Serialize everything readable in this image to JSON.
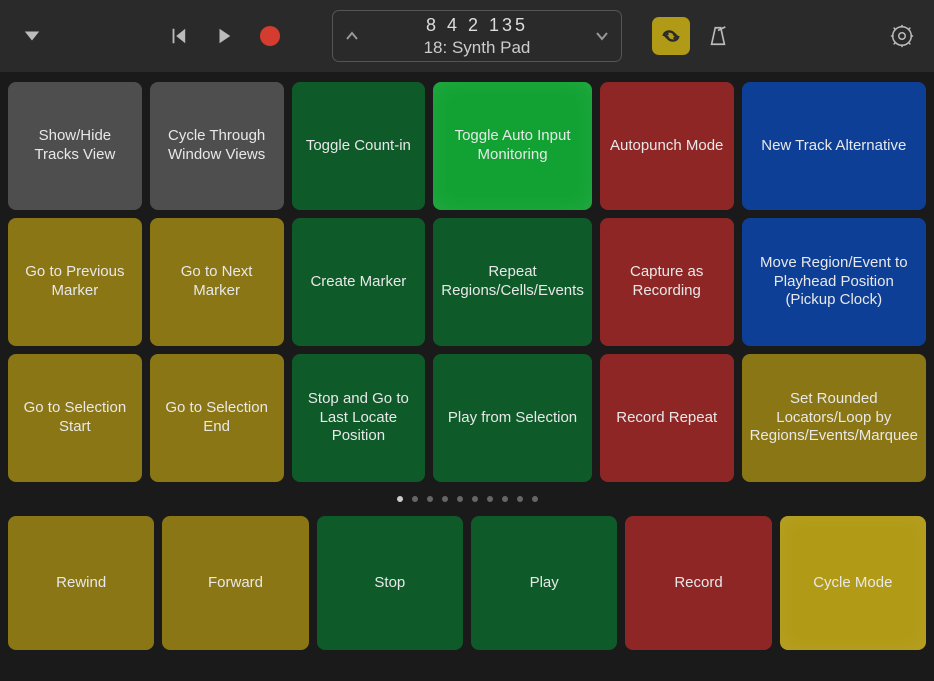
{
  "toolbar": {
    "display_top": "8  4  2  135",
    "display_bottom": "18: Synth Pad"
  },
  "pads": {
    "row1": [
      {
        "label": "Show/Hide Tracks View",
        "color": "c-gray"
      },
      {
        "label": "Cycle Through Window Views",
        "color": "c-gray"
      },
      {
        "label": "Toggle Count-in",
        "color": "c-green"
      },
      {
        "label": "Toggle Auto Input Monitoring",
        "color": "c-green-bright"
      },
      {
        "label": "Autopunch Mode",
        "color": "c-red"
      },
      {
        "label": "New Track Alternative",
        "color": "c-blue"
      }
    ],
    "row2": [
      {
        "label": "Go to Previous Marker",
        "color": "c-olive"
      },
      {
        "label": "Go to Next Marker",
        "color": "c-olive"
      },
      {
        "label": "Create Marker",
        "color": "c-green"
      },
      {
        "label": "Repeat Regions/Cells/Events",
        "color": "c-green"
      },
      {
        "label": "Capture as Recording",
        "color": "c-red"
      },
      {
        "label": "Move Region/Event to Playhead Position (Pickup Clock)",
        "color": "c-blue"
      }
    ],
    "row3": [
      {
        "label": "Go to Selection Start",
        "color": "c-olive"
      },
      {
        "label": "Go to Selection End",
        "color": "c-olive"
      },
      {
        "label": "Stop and Go to Last Locate Position",
        "color": "c-green"
      },
      {
        "label": "Play from Selection",
        "color": "c-green"
      },
      {
        "label": "Record Repeat",
        "color": "c-red"
      },
      {
        "label": "Set Rounded Locators/Loop by Regions/Events/Marquee",
        "color": "c-olive"
      }
    ]
  },
  "pages": {
    "count": 10,
    "active": 0
  },
  "transport": [
    {
      "label": "Rewind",
      "color": "c-olive"
    },
    {
      "label": "Forward",
      "color": "c-olive"
    },
    {
      "label": "Stop",
      "color": "c-green"
    },
    {
      "label": "Play",
      "color": "c-green"
    },
    {
      "label": "Record",
      "color": "c-red"
    },
    {
      "label": "Cycle Mode",
      "color": "c-olive-bright"
    }
  ]
}
